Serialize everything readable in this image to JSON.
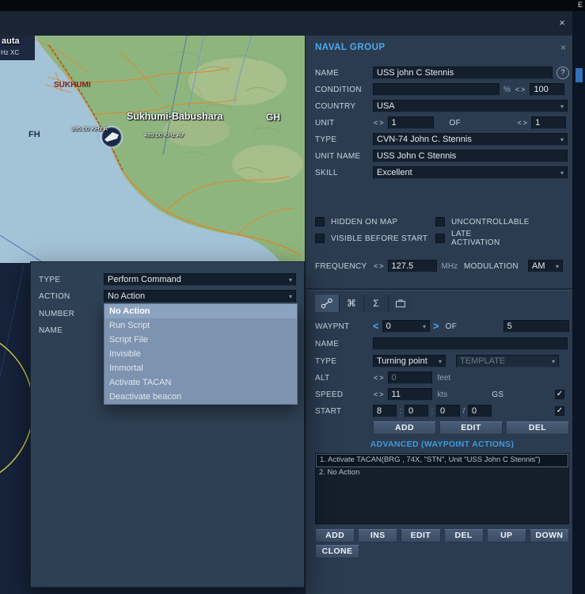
{
  "ui": {
    "close": "×",
    "help": "?",
    "chevron": "▾",
    "left": "<",
    "right": ">",
    "percent": "%",
    "colon": ":",
    "slash": "/",
    "check": "✓",
    "window_edge_text": "E"
  },
  "map": {
    "labels": {
      "auta": "auta",
      "hz_xc": "Hz XC",
      "sukhumi": "SUKHUMI",
      "babushara": "Sukhumi-Babushara",
      "gh": "GH",
      "fh": "FH",
      "freq_a": "995.00 KHz A",
      "freq_av": "489.00 KHz AV"
    }
  },
  "naval_group": {
    "title": "NAVAL GROUP",
    "fields": {
      "name": {
        "label": "NAME",
        "value": "USS john C Stennis"
      },
      "condition": {
        "label": "CONDITION",
        "value": "",
        "max": "100"
      },
      "country": {
        "label": "COUNTRY",
        "value": "USA"
      },
      "unit": {
        "label": "UNIT",
        "index": "1",
        "of": "OF",
        "count": "1"
      },
      "type": {
        "label": "TYPE",
        "value": "CVN-74 John C. Stennis"
      },
      "unit_name": {
        "label": "UNIT NAME",
        "value": "USS John C Stennis"
      },
      "skill": {
        "label": "SKILL",
        "value": "Excellent"
      }
    },
    "checkboxes": {
      "hidden": "HIDDEN ON MAP",
      "uncontrollable": "UNCONTROLLABLE",
      "visible": "VISIBLE BEFORE START",
      "late": "LATE ACTIVATION"
    },
    "frequency": {
      "label": "FREQUENCY",
      "value": "127.5",
      "unit": "MHz",
      "mod_label": "MODULATION",
      "mod_value": "AM"
    }
  },
  "waypoint": {
    "tabs": [
      {
        "name": "route"
      },
      {
        "name": "command",
        "glyph": "⌘"
      },
      {
        "name": "summary",
        "glyph": "Σ"
      },
      {
        "name": "cargo"
      }
    ],
    "waypnt": {
      "label": "WAYPNT",
      "value": "0",
      "of": "OF",
      "total": "5"
    },
    "name": {
      "label": "NAME",
      "value": ""
    },
    "type": {
      "label": "TYPE",
      "value": "Turning point",
      "template": "TEMPLATE"
    },
    "alt": {
      "label": "ALT",
      "value": "0",
      "unit": "feet"
    },
    "speed": {
      "label": "SPEED",
      "value": "11",
      "unit": "kts",
      "gs": "GS"
    },
    "start": {
      "label": "START",
      "h": "8",
      "m": "0",
      "s": "0",
      "d": "0"
    },
    "buttons": {
      "add": "ADD",
      "edit": "EDIT",
      "del": "DEL"
    },
    "advanced": "ADVANCED (WAYPOINT ACTIONS)",
    "actions": [
      "1. Activate TACAN(BRG , 74X, \"STN\", Unit \"USS John C Stennis\")",
      "2. No Action"
    ],
    "list_buttons": {
      "add": "ADD",
      "ins": "INS",
      "edit": "EDIT",
      "del": "DEL",
      "up": "UP",
      "down": "DOWN",
      "clone": "CLONE"
    }
  },
  "action_dialog": {
    "rows": {
      "type": {
        "label": "TYPE",
        "value": "Perform Command"
      },
      "action": {
        "label": "ACTION",
        "value": "No Action"
      },
      "number": {
        "label": "NUMBER"
      },
      "name": {
        "label": "NAME"
      }
    },
    "options": [
      "No Action",
      "Run Script",
      "Script File",
      "Invisible",
      "Immortal",
      "Activate TACAN",
      "Deactivate beacon"
    ]
  }
}
